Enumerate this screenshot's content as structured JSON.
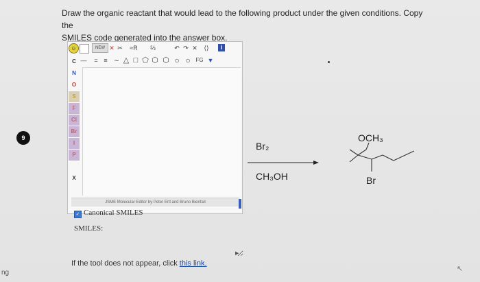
{
  "question": {
    "text_line1": "Draw the organic reactant that would lead to the following product under the given conditions. Copy the",
    "text_line2": "SMILES code generated into the answer box."
  },
  "left_fragment": "ng",
  "question_badge": "9",
  "editor": {
    "toolbar_row1": [
      "NEW",
      "✕",
      "✂",
      "≈R",
      "⅔",
      "↶",
      "↷",
      "✕",
      "⟨⟩",
      "i"
    ],
    "toolbar_row2": [
      "—",
      "=",
      "≡",
      "∼",
      "△",
      "□",
      "⬠",
      "⬡",
      "⬡",
      "○",
      "○",
      "FG",
      "▼"
    ],
    "atoms": [
      "C",
      "N",
      "O",
      "S",
      "F",
      "Cl",
      "Br",
      "I",
      "P",
      "X"
    ],
    "credit": "JSME Molecular Editor by Peter Ertl and Bruno Bienfait",
    "canonical_label": "Canonical SMILES",
    "smiles_label": "SMILES:"
  },
  "answer_box_value": "",
  "fallback": {
    "prefix": "If the tool does not appear, click ",
    "link": "this link."
  },
  "reaction": {
    "reagent_top": "Br₂",
    "reagent_bottom": "CH₃OH",
    "product_substituent_top": "OCH₃",
    "product_substituent_bottom": "Br"
  }
}
